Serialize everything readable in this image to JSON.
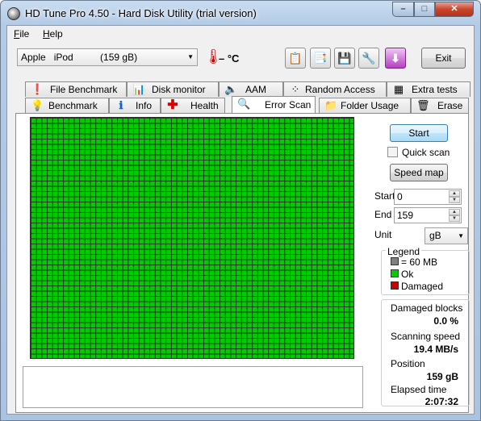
{
  "window": {
    "title": "HD Tune Pro 4.50 - Hard Disk Utility (trial version)",
    "controls": {
      "minimize": "–",
      "maximize": "□",
      "close": "✕"
    }
  },
  "menu": {
    "file": "File",
    "help": "Help"
  },
  "toolbar": {
    "drive": "Apple   iPod          (159 gB)",
    "temperature": "– °C",
    "exit_label": "Exit",
    "icons": [
      "copy-text-icon",
      "copy-screenshot-icon",
      "save-icon",
      "options-icon",
      "download-icon"
    ]
  },
  "tabs": {
    "row_back": [
      {
        "label": "File Benchmark",
        "icon": "file-benchmark-icon"
      },
      {
        "label": "Disk monitor",
        "icon": "disk-monitor-icon"
      },
      {
        "label": "AAM",
        "icon": "speaker-icon"
      },
      {
        "label": "Random Access",
        "icon": "random-access-icon"
      },
      {
        "label": "Extra tests",
        "icon": "extra-tests-icon"
      }
    ],
    "row_front": [
      {
        "label": "Benchmark",
        "icon": "benchmark-icon"
      },
      {
        "label": "Info",
        "icon": "info-icon"
      },
      {
        "label": "Health",
        "icon": "health-icon"
      },
      {
        "label": "Error Scan",
        "icon": "magnifier-icon"
      },
      {
        "label": "Folder Usage",
        "icon": "folder-icon"
      },
      {
        "label": "Erase",
        "icon": "trash-icon"
      }
    ],
    "active": "Error Scan"
  },
  "error_scan": {
    "start_label": "Start",
    "quick_scan_label": "Quick scan",
    "quick_scan_checked": false,
    "speed_map_label": "Speed map",
    "start_field_label": "Start",
    "start_value": "0",
    "end_field_label": "End",
    "end_value": "159",
    "unit_label": "Unit",
    "unit_value": "gB",
    "legend": {
      "title": "Legend",
      "items": [
        {
          "label": "= 60 MB",
          "color": "#808080"
        },
        {
          "label": "Ok",
          "color": "#00cc00"
        },
        {
          "label": "Damaged",
          "color": "#cc0000"
        }
      ]
    },
    "stats": {
      "damaged_label": "Damaged blocks",
      "damaged_value": "0.0 %",
      "speed_label": "Scanning speed",
      "speed_value": "19.4 MB/s",
      "position_label": "Position",
      "position_value": "159 gB",
      "elapsed_label": "Elapsed time",
      "elapsed_value": "2:07:32"
    },
    "block_color": "#00cc00"
  }
}
